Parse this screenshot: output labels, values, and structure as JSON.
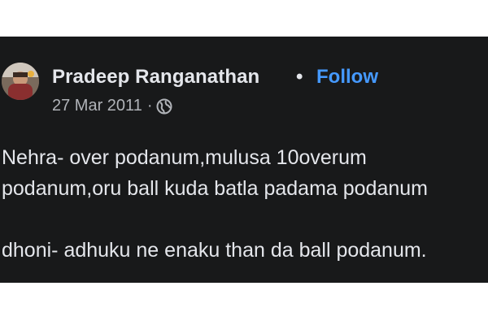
{
  "post": {
    "author": "Pradeep Ranganathan",
    "separator": "•",
    "follow_label": "Follow",
    "date": "27 Mar 2011",
    "meta_dot": "·",
    "privacy_icon": "globe-icon",
    "body": {
      "line1": "Nehra- over podanum,mulusa 10overum",
      "line2": "podanum,oru ball kuda batla padama podanum",
      "line3": "dhoni- adhuku ne enaku than da ball podanum."
    }
  },
  "colors": {
    "background": "#18191a",
    "primary_text": "#e4e6eb",
    "secondary_text": "#b0b3b8",
    "link": "#4599ff"
  }
}
